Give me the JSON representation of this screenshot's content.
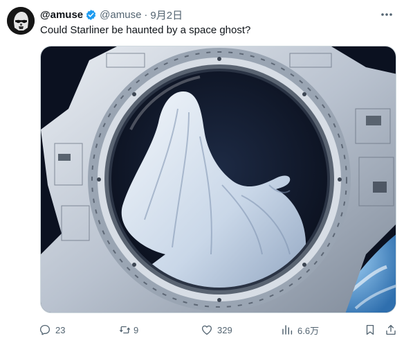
{
  "author": {
    "display_name": "@amuse",
    "handle": "@amuse",
    "separator": "·",
    "timestamp": "9月2日",
    "verified": true
  },
  "post": {
    "text": "Could Starliner be haunted by a space ghost?"
  },
  "media": {
    "icon": "ghost-in-spacecraft-window-image"
  },
  "actions": {
    "replies": "23",
    "reposts": "9",
    "likes": "329",
    "views": "6.6万"
  },
  "colors": {
    "text": "#0f1419",
    "secondary": "#536471",
    "verified": "#1d9bf0",
    "border": "#cfd9de"
  }
}
